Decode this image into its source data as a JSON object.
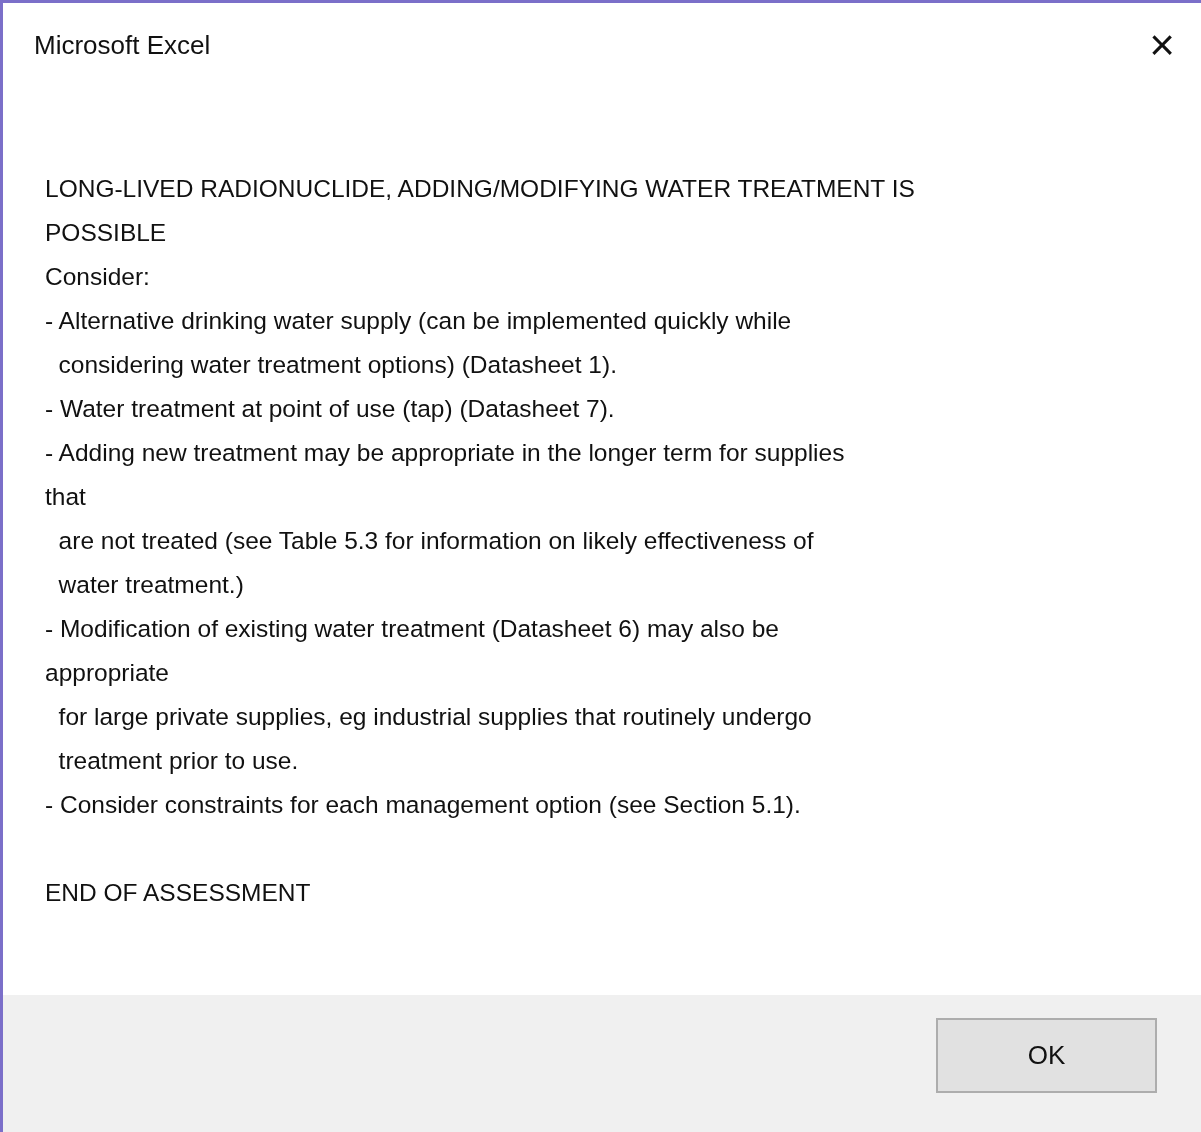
{
  "window": {
    "title": "Microsoft Excel",
    "close": "×"
  },
  "message": {
    "lines": [
      "LONG-LIVED RADIONUCLIDE, ADDING/MODIFYING WATER TREATMENT IS",
      "POSSIBLE",
      "Consider:",
      "- Alternative drinking water supply (can be implemented quickly while",
      "  considering water treatment options) (Datasheet 1).",
      "- Water treatment at point of use (tap) (Datasheet 7).",
      "- Adding new treatment may be appropriate in the longer term for supplies",
      "that",
      "  are not treated (see Table 5.3 for information on likely effectiveness of",
      "  water treatment.)",
      "- Modification of existing water treatment (Datasheet 6) may also be",
      "appropriate",
      "  for large private supplies, eg industrial supplies that routinely undergo",
      "  treatment prior to use.",
      "- Consider constraints for each management option (see Section 5.1)."
    ],
    "end_note": "END OF ASSESSMENT"
  },
  "buttons": [
    "OK"
  ]
}
